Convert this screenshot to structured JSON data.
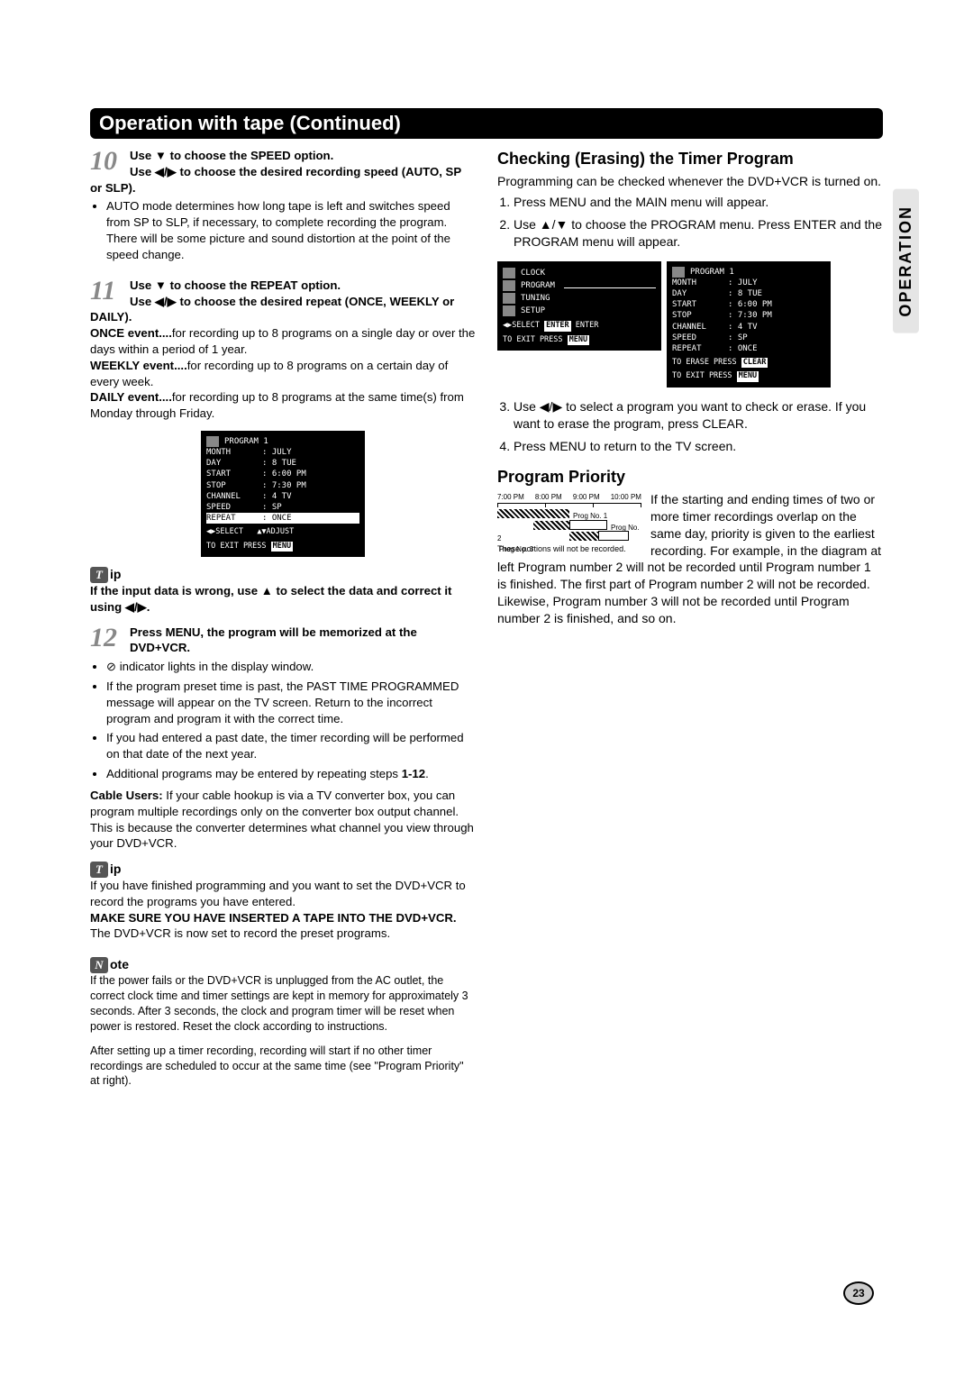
{
  "header": {
    "title": "Operation with tape (Continued)"
  },
  "sideTab": "OPERATION",
  "pageNumber": "23",
  "left": {
    "step10": {
      "num": "10",
      "line1": "Use ▼ to choose the SPEED option.",
      "line2": "Use ◀/▶ to choose the desired recording speed (AUTO, SP or SLP).",
      "bullet1": "AUTO mode determines how long tape is left and switches speed from SP to SLP, if necessary, to complete recording the program. There will be some picture and sound distortion at the point of the speed change."
    },
    "step11": {
      "num": "11",
      "line1": "Use ▼ to choose the REPEAT option.",
      "line2": "Use ◀/▶ to choose the desired repeat (ONCE, WEEKLY or DAILY).",
      "once_b": "ONCE event....",
      "once_t": "for recording up to 8 programs on a single day or over the days within a period of 1 year.",
      "weekly_b": "WEEKLY event....",
      "weekly_t": "for recording up to 8 programs on a certain day of every week.",
      "daily_b": "DAILY event....",
      "daily_t": "for recording up to 8 programs at the same time(s) from Monday through Friday."
    },
    "osd1": {
      "title": "PROGRAM  1",
      "rows": [
        {
          "k": "MONTH",
          "v": ": JULY"
        },
        {
          "k": "DAY",
          "v": ": 8  TUE"
        },
        {
          "k": "START",
          "v": ": 6:00 PM"
        },
        {
          "k": "STOP",
          "v": ": 7:30 PM"
        },
        {
          "k": "CHANNEL",
          "v": ": 4  TV"
        },
        {
          "k": "SPEED",
          "v": ": SP"
        }
      ],
      "repeat_k": "REPEAT",
      "repeat_v": ": ONCE",
      "foot1a": "◀▶SELECT",
      "foot1b": "▲▼ADJUST",
      "foot2a": "TO EXIT PRESS",
      "foot2b": "MENU"
    },
    "tip1_label": "ip",
    "tip1_text": "If the input data is wrong, use ▲ to select the data and correct it using ◀/▶.",
    "step12": {
      "num": "12",
      "line1": "Press MENU, the program will be memorized at the DVD+VCR.",
      "b1": "⊘ indicator lights in the display window.",
      "b2": "If the program preset time is past, the PAST TIME PROGRAMMED message will appear on the TV screen. Return to the incorrect program and program it with the correct time.",
      "b3": "If you had entered a past date, the timer recording will be performed on that date of the next year.",
      "b4_pre": "Additional programs may be entered by repeating steps ",
      "b4_bold": "1-12",
      "b4_post": ".",
      "cable_b": "Cable Users:",
      "cable_t": " If your cable hookup is via a TV converter box, you can program multiple recordings only on the converter box output channel. This is because the converter determines what channel you view through your DVD+VCR."
    },
    "tip2_label": "ip",
    "tip2_p1": "If you have finished programming and you want to set the DVD+VCR to record the programs you have entered.",
    "tip2_b": "MAKE SURE YOU HAVE INSERTED A TAPE INTO THE DVD+VCR.",
    "tip2_p2": " The DVD+VCR is now set to record the preset programs.",
    "note_label": "ote",
    "note_p1": "If the power fails or the DVD+VCR is unplugged from the AC outlet, the correct clock time and timer settings are kept in memory for approximately 3 seconds. After 3 seconds, the clock and program timer will be reset when power is restored. Reset the clock according to instructions.",
    "note_p2": "After setting up a timer recording, recording will start if no other timer recordings are scheduled to occur at the same time (see \"Program Priority\" at right)."
  },
  "right": {
    "h_check": "Checking (Erasing) the Timer Program",
    "check_intro": "Programming can be checked whenever the DVD+VCR is turned on.",
    "check_steps": [
      "Press MENU and the MAIN menu will appear.",
      "Use ▲/▼ to choose the PROGRAM menu. Press ENTER and the PROGRAM menu will appear."
    ],
    "menu_left": {
      "items": [
        "CLOCK",
        "PROGRAM",
        "TUNING",
        "SETUP"
      ],
      "foot1a": "◀▶SELECT",
      "foot1b": "ENTER",
      "foot1c": "ENTER",
      "foot2a": "TO EXIT PRESS",
      "foot2b": "MENU"
    },
    "menu_right": {
      "title": "PROGRAM  1",
      "rows": [
        {
          "k": "MONTH",
          "v": ": JULY"
        },
        {
          "k": "DAY",
          "v": ": 8  TUE"
        },
        {
          "k": "START",
          "v": ": 6:00 PM"
        },
        {
          "k": "STOP",
          "v": ": 7:30 PM"
        },
        {
          "k": "CHANNEL",
          "v": ": 4  TV"
        },
        {
          "k": "SPEED",
          "v": ": SP"
        },
        {
          "k": "REPEAT",
          "v": ": ONCE"
        }
      ],
      "foot1a": "TO ERASE PRESS",
      "foot1b": "CLEAR",
      "foot2a": "TO EXIT PRESS",
      "foot2b": "MENU"
    },
    "check_step3": "Use ◀/▶ to select a program you want to check or erase. If you want to erase the program, press CLEAR.",
    "check_step4": "Press MENU to return to the TV screen.",
    "h_prio": "Program Priority",
    "prio_times": [
      "7:00 PM",
      "8:00 PM",
      "9:00 PM",
      "10:00 PM"
    ],
    "prio_labels": {
      "p1": "Prog No. 1",
      "p2": "Prog No. 2",
      "p3": "Prog No. 3"
    },
    "prio_caption": "These portions will not be recorded.",
    "prio_text": "If the starting and ending times of two or more timer recordings overlap on the same day, priority is given to the earliest recording. For example, in the diagram at left Program number 2 will not be recorded until Program number 1 is finished. The first part of Program number 2 will not be recorded. Likewise, Program number 3 will not be recorded until Program number 2 is finished, and so on."
  }
}
